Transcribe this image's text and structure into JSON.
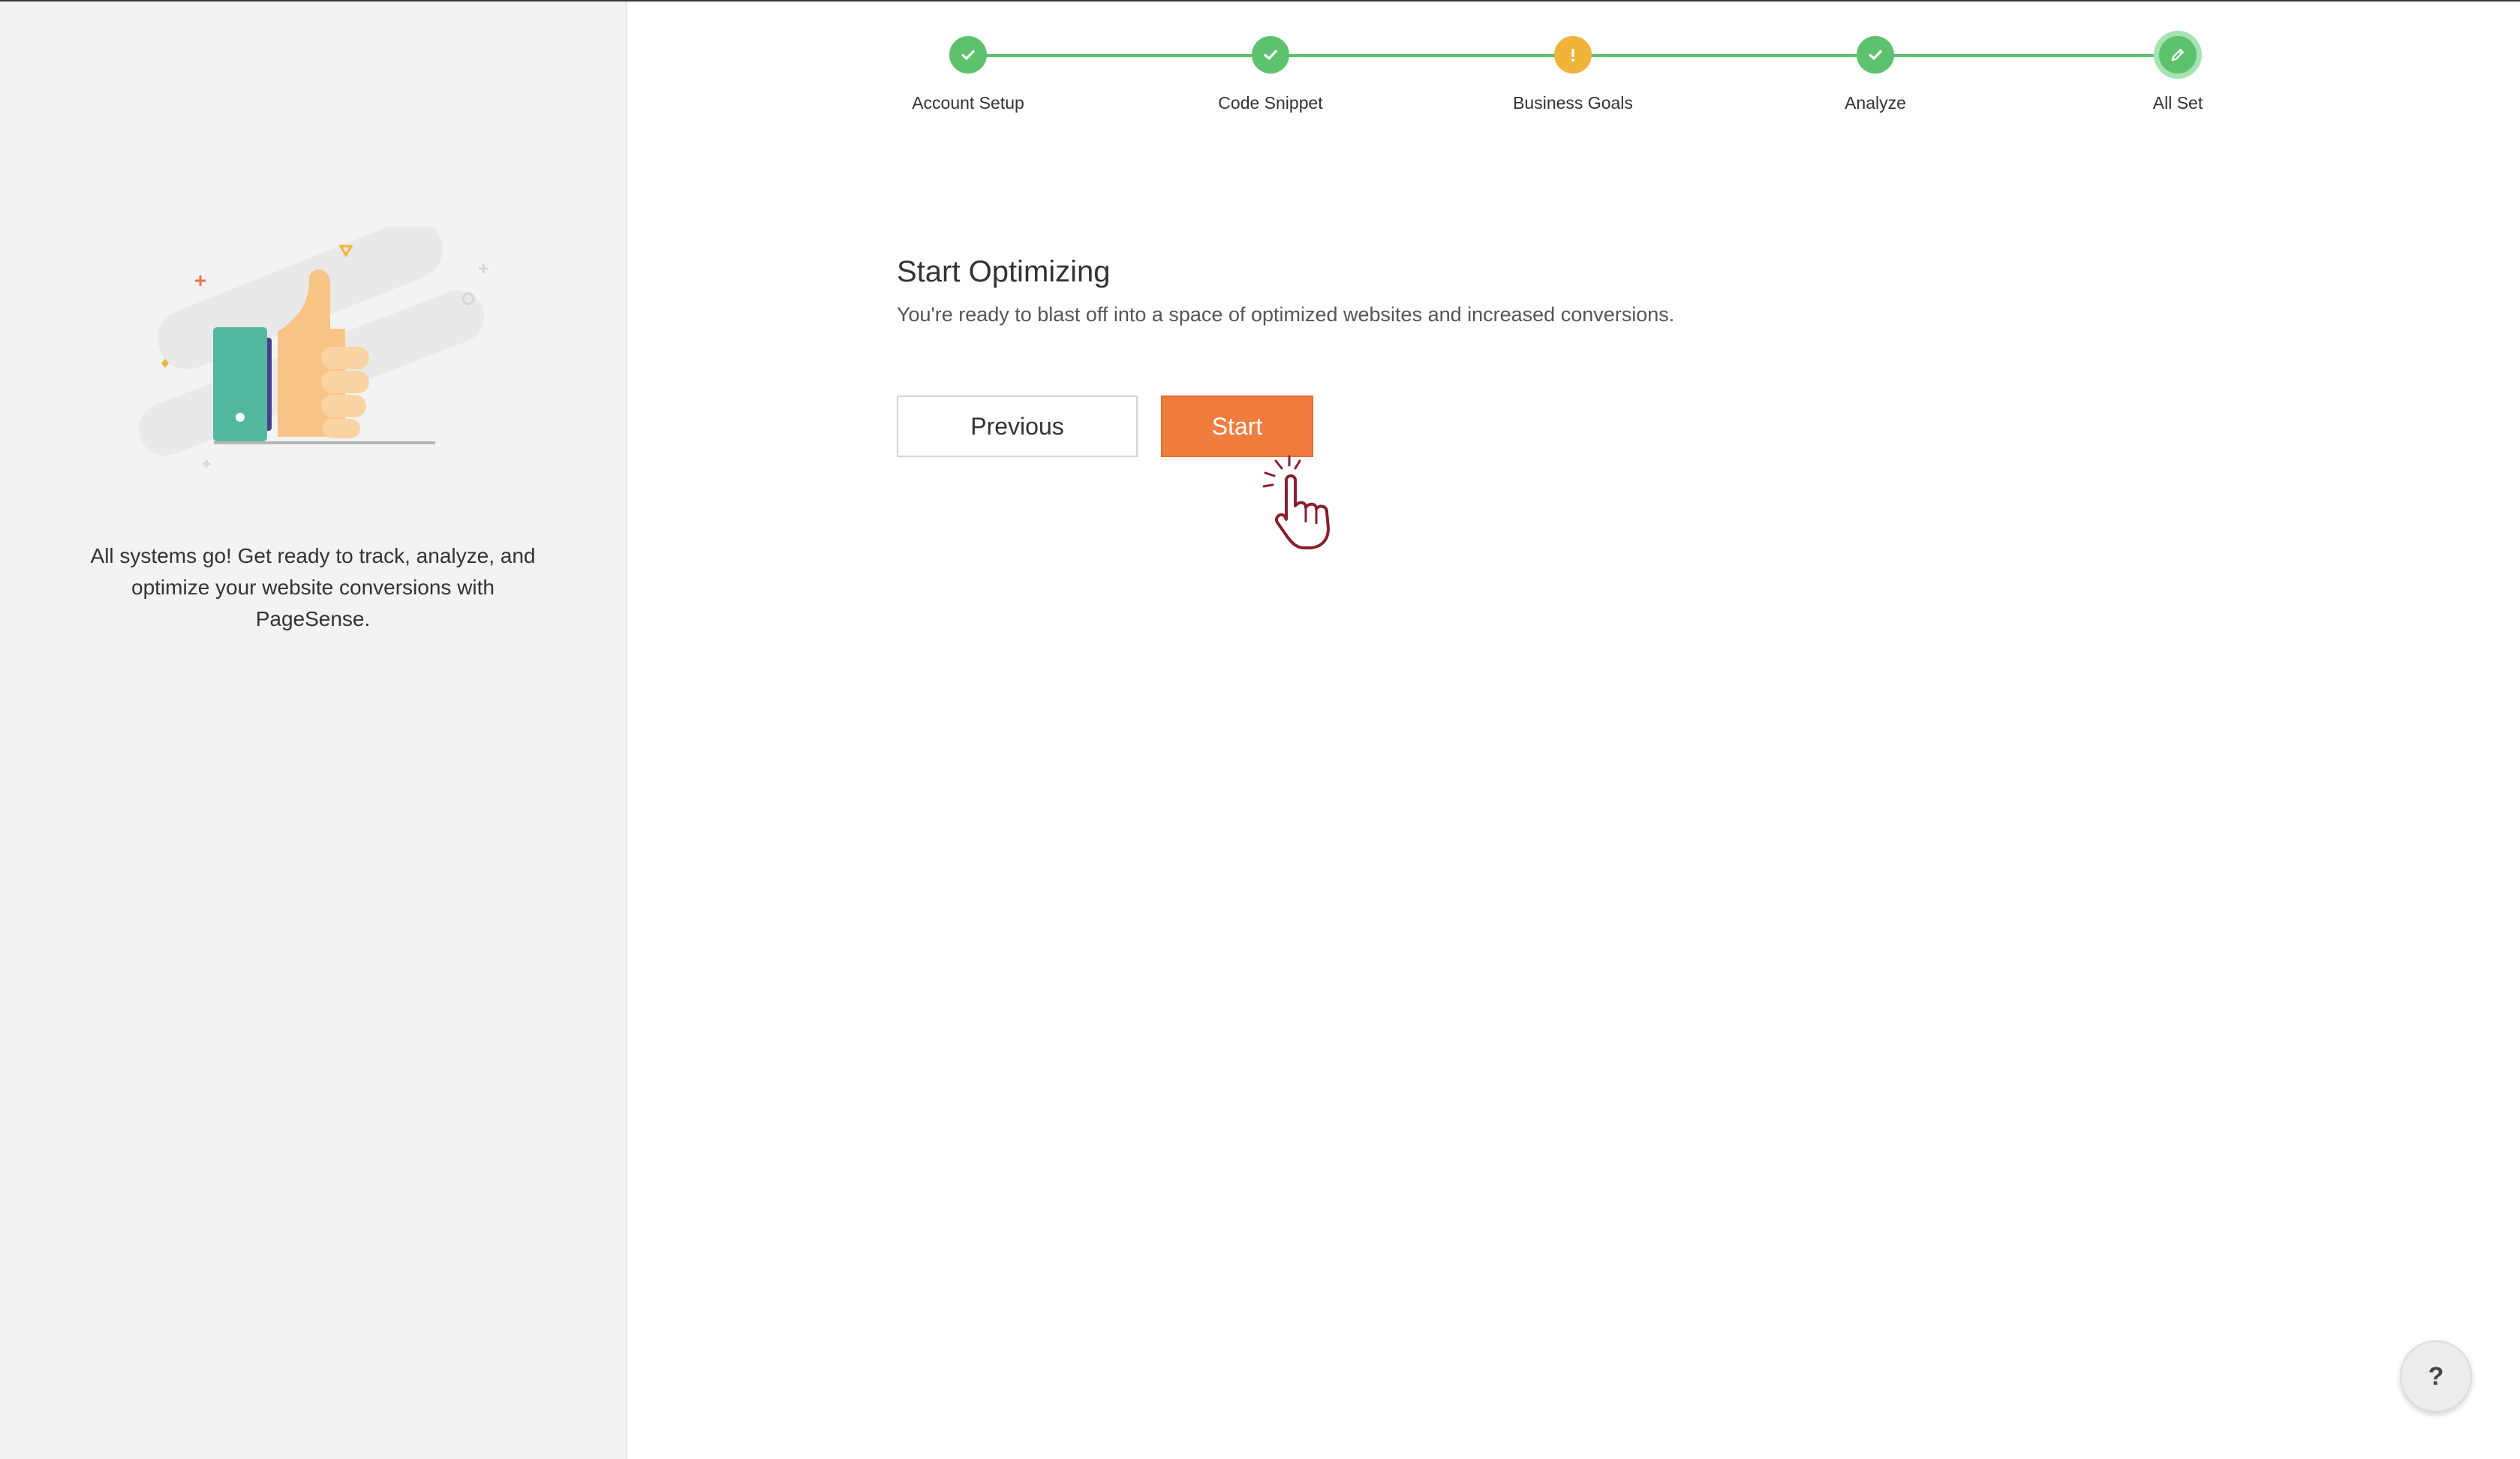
{
  "sidebar": {
    "message": "All systems go! Get ready to track, analyze, and optimize your website conversions with PageSense.",
    "illustration_icon": "thumbs-up-illustration"
  },
  "stepper": {
    "steps": [
      {
        "label": "Account Setup",
        "status": "done",
        "icon": "check-icon"
      },
      {
        "label": "Code Snippet",
        "status": "done",
        "icon": "check-icon"
      },
      {
        "label": "Business Goals",
        "status": "warning",
        "icon": "exclamation-icon"
      },
      {
        "label": "Analyze",
        "status": "done",
        "icon": "check-icon"
      },
      {
        "label": "All Set",
        "status": "current",
        "icon": "pencil-icon"
      }
    ]
  },
  "main": {
    "title": "Start Optimizing",
    "description": "You're ready to blast off into a space of optimized websites and increased conversions.",
    "previous_label": "Previous",
    "start_label": "Start"
  },
  "help": {
    "label": "?"
  },
  "colors": {
    "accent": "#f07c3e",
    "success": "#5cc26d",
    "warning": "#f0b43a",
    "sidebar_bg": "#f3f3f3"
  }
}
